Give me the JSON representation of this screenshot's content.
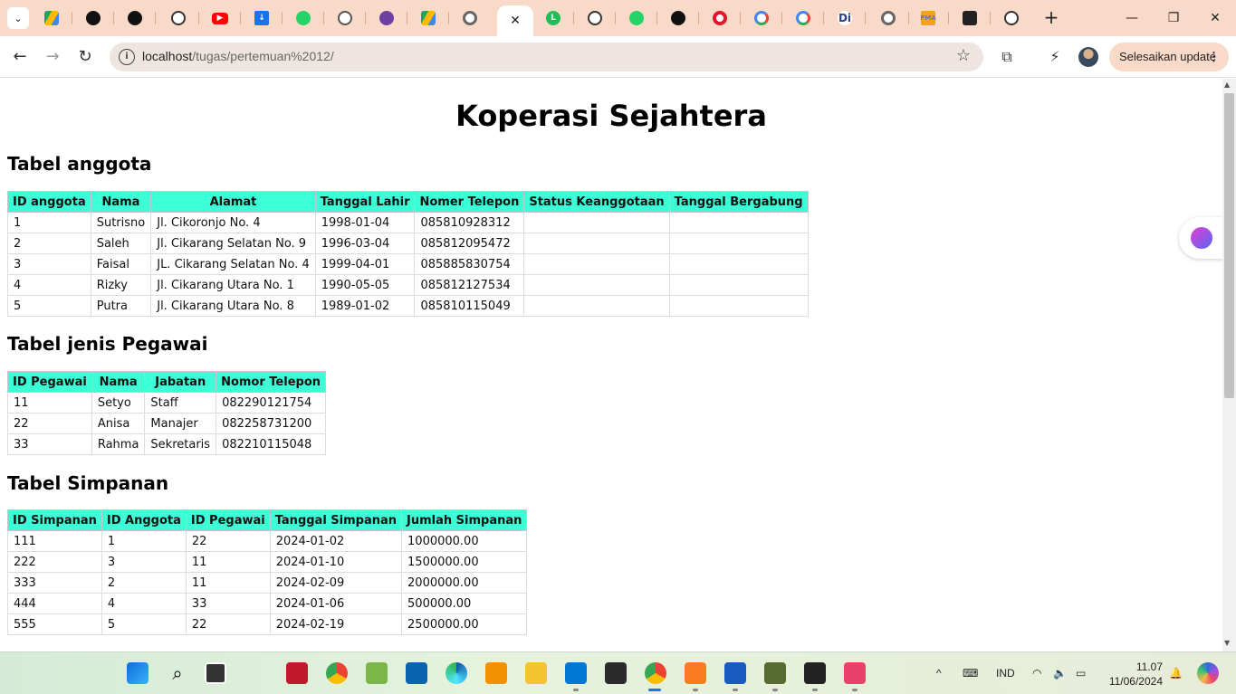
{
  "browser": {
    "active_tab_close": "✕",
    "new_tab": "+",
    "url_host": "localhost",
    "url_path": "/tugas/pertemuan%2012/",
    "update_button": "Selesaikan update"
  },
  "page": {
    "title": "Koperasi Sejahtera",
    "anggota": {
      "heading": "Tabel anggota",
      "columns": [
        "ID anggota",
        "Nama",
        "Alamat",
        "Tanggal Lahir",
        "Nomer Telepon",
        "Status Keanggotaan",
        "Tanggal Bergabung"
      ],
      "rows": [
        [
          "1",
          "Sutrisno",
          "Jl. Cikoronjo No. 4",
          "1998-01-04",
          "085810928312",
          "",
          ""
        ],
        [
          "2",
          "Saleh",
          "Jl. Cikarang Selatan No. 9",
          "1996-03-04",
          "085812095472",
          "",
          ""
        ],
        [
          "3",
          "Faisal",
          "JL. Cikarang Selatan No. 4",
          "1999-04-01",
          "085885830754",
          "",
          ""
        ],
        [
          "4",
          "Rizky",
          "Jl. Cikarang Utara No. 1",
          "1990-05-05",
          "085812127534",
          "",
          ""
        ],
        [
          "5",
          "Putra",
          "Jl. Cikarang Utara No. 8",
          "1989-01-02",
          "085810115049",
          "",
          ""
        ]
      ]
    },
    "pegawai": {
      "heading": "Tabel jenis Pegawai",
      "columns": [
        "ID Pegawai",
        "Nama",
        "Jabatan",
        "Nomor Telepon"
      ],
      "rows": [
        [
          "11",
          "Setyo",
          "Staff",
          "082290121754"
        ],
        [
          "22",
          "Anisa",
          "Manajer",
          "082258731200"
        ],
        [
          "33",
          "Rahma",
          "Sekretaris",
          "082210115048"
        ]
      ]
    },
    "simpanan": {
      "heading": "Tabel Simpanan",
      "columns": [
        "ID Simpanan",
        "ID Anggota",
        "ID Pegawai",
        "Tanggal Simpanan",
        "Jumlah Simpanan"
      ],
      "rows": [
        [
          "111",
          "1",
          "22",
          "2024-01-02",
          "1000000.00"
        ],
        [
          "222",
          "3",
          "11",
          "2024-01-10",
          "1500000.00"
        ],
        [
          "333",
          "2",
          "11",
          "2024-02-09",
          "2000000.00"
        ],
        [
          "444",
          "4",
          "33",
          "2024-01-06",
          "500000.00"
        ],
        [
          "555",
          "5",
          "22",
          "2024-02-19",
          "2500000.00"
        ]
      ]
    }
  },
  "taskbar": {
    "language": "IND",
    "time": "11.07",
    "date": "11/06/2024"
  },
  "colors": {
    "tabstrip": "#f9d9c8",
    "table_header": "#3dffd7"
  }
}
